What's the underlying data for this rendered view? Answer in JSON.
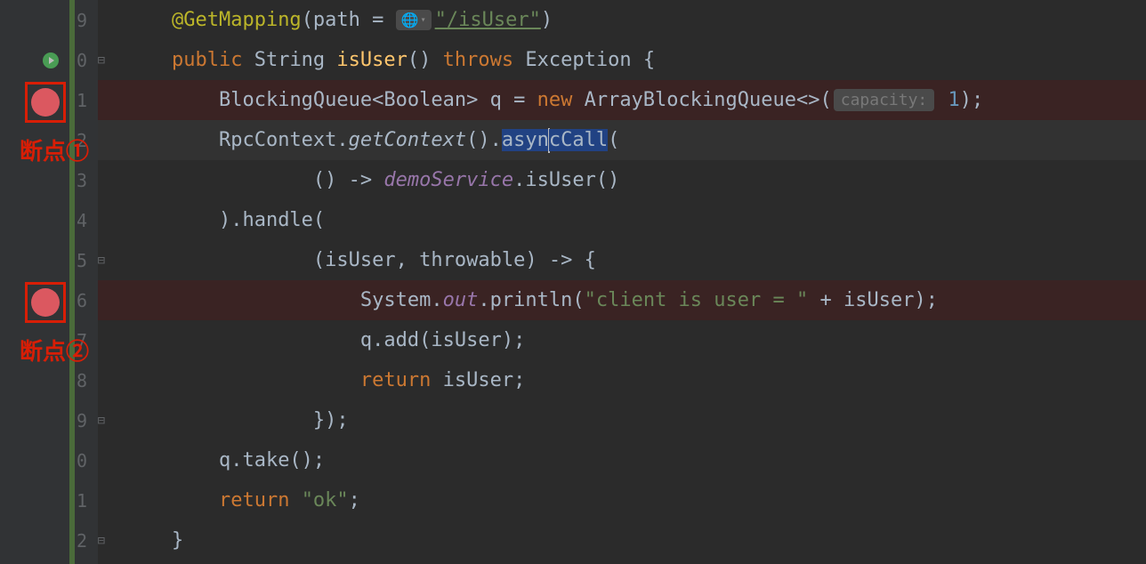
{
  "lineNumbers": [
    "9",
    "0",
    "1",
    "2",
    "3",
    "4",
    "5",
    "6",
    "7",
    "8",
    "9",
    "0",
    "1",
    "2"
  ],
  "code": {
    "l1": {
      "anno": "@GetMapping",
      "op": "(path = ",
      "url": "\"/isUser\"",
      "close": ")"
    },
    "l2": {
      "pub": "public ",
      "type": "String ",
      "method": "isUser",
      "paren": "() ",
      "throws": "throws ",
      "exc": "Exception {"
    },
    "l3": {
      "indent": "    ",
      "type": "BlockingQueue<Boolean> q = ",
      "new": "new ",
      "ctor": "ArrayBlockingQueue<>(",
      "hint": "capacity:",
      "num": " 1",
      "end": ");"
    },
    "l4": {
      "indent": "    ",
      "cls": "RpcContext.",
      "get": "getContext",
      "dot": "().",
      "async1": "asyn",
      "async2": "cCall",
      "open": "("
    },
    "l5": {
      "indent": "            () -> ",
      "svc": "demoService",
      "dot": ".isUser()"
    },
    "l6": {
      "indent": "    ).handle("
    },
    "l7": {
      "indent": "            (isUser, throwable) -> {"
    },
    "l8": {
      "indent": "                System.",
      "out": "out",
      "dot": ".println(",
      "str": "\"client is user = \"",
      "plus": " + isUser);"
    },
    "l9": {
      "indent": "                q.add(isUser);"
    },
    "l10": {
      "indent": "                ",
      "ret": "return ",
      "val": "isUser;"
    },
    "l11": {
      "indent": "            });"
    },
    "l12": {
      "indent": "    q.take();"
    },
    "l13": {
      "indent": "    ",
      "ret": "return ",
      "str": "\"ok\"",
      "semi": ";"
    },
    "l14": {
      "indent": "}"
    }
  },
  "annotations": {
    "bp1": "断点①",
    "bp2": "断点②"
  }
}
